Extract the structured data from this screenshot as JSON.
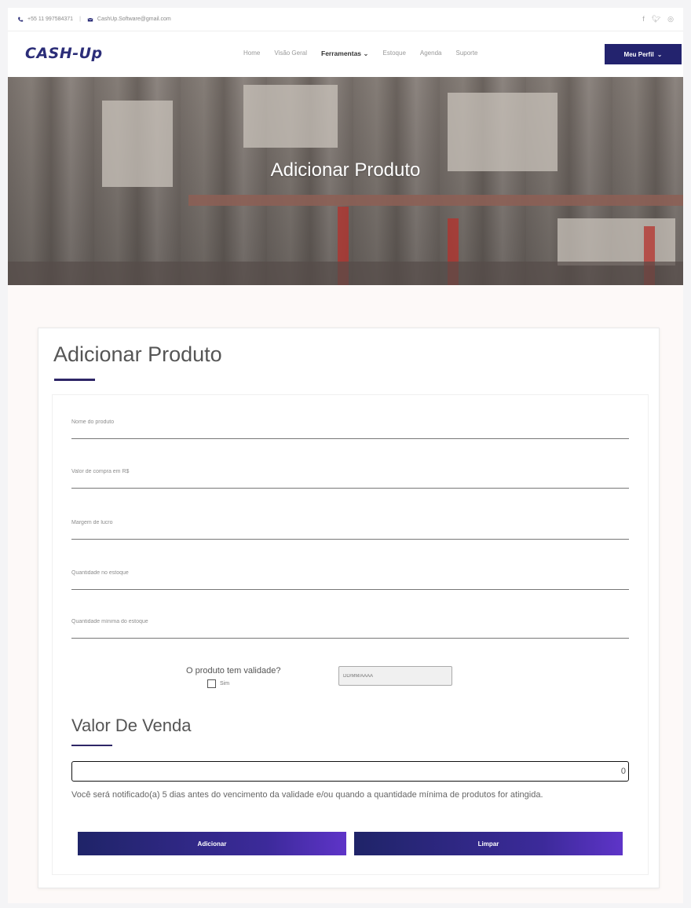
{
  "topbar": {
    "phone": "+55 11 997584371",
    "email": "CashUp.Software@gmail.com",
    "socials": [
      "f",
      "t",
      "ig"
    ]
  },
  "nav": {
    "logo": "CASH-Up",
    "links": [
      "Home",
      "Visão Geral",
      "Ferramentas",
      "Estoque",
      "Agenda",
      "Suporte"
    ],
    "active_link": "Ferramentas",
    "profile_label": "Meu Perfil"
  },
  "hero": {
    "title": "Adicionar Produto"
  },
  "form": {
    "title": "Adicionar Produto",
    "fields": [
      "Nome do produto",
      "Valor de compra em R$",
      "Margem de lucro",
      "Quantidade no estoque",
      "Quantidade mínima do estoque"
    ],
    "validade_question": "O produto tem validade?",
    "validade_checkbox_label": "Sim",
    "validade_checked": false,
    "date_placeholder": "DD/MM/AAAA",
    "sale_section_title": "Valor De Venda",
    "sale_value": "0",
    "notice": "Você será notificado(a) 5 dias antes do vencimento da validade e/ou quando a quantidade mínima de produtos for atingida.",
    "add_button": "Adicionar",
    "clear_button": "Limpar"
  },
  "colors": {
    "brand": "#2b2d78",
    "button_gradient_start": "#1f2468",
    "button_gradient_end": "#5e34c8"
  }
}
